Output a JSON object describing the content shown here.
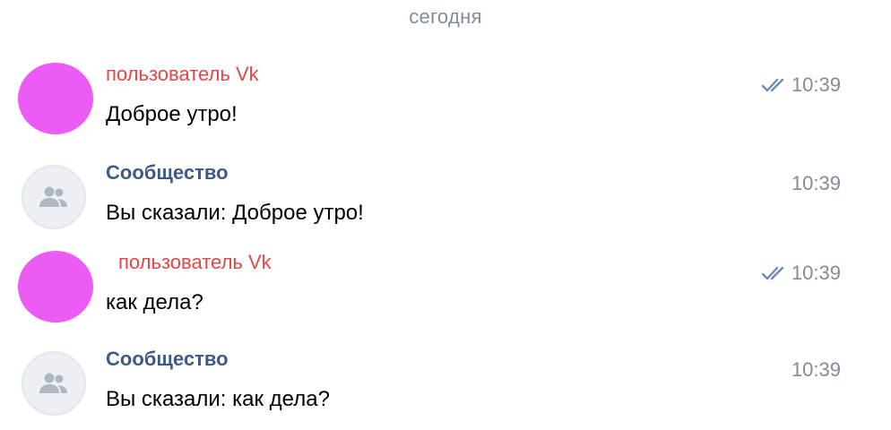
{
  "date_separator": "сегодня",
  "messages": [
    {
      "author": "пользователь Vk",
      "text": "Доброе утро!",
      "time": "10:39",
      "read": true,
      "avatar_color": "#ec5cf5"
    },
    {
      "author": "Сообщество",
      "text": "Вы сказали: Доброе утро!",
      "time": "10:39",
      "read": false
    },
    {
      "author": "пользователь Vk",
      "text": "как дела?",
      "time": "10:39",
      "read": true,
      "avatar_color": "#ec5cf5"
    },
    {
      "author": "Сообщество",
      "text": "Вы сказали: как дела?",
      "time": "10:39",
      "read": false
    }
  ],
  "colors": {
    "user_name": "#e64646",
    "community_name": "#3f5b85",
    "time": "#818c99",
    "read_check": "#6b8cb8"
  }
}
